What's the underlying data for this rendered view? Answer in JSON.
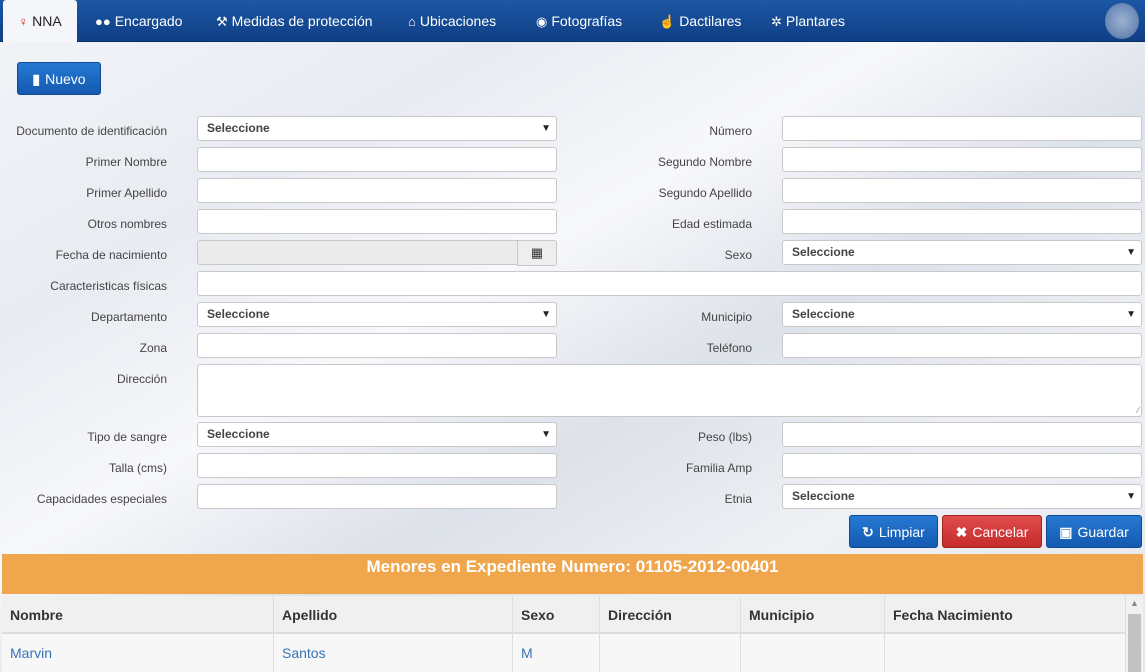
{
  "tabs": [
    {
      "label": "NNA",
      "icon": "child-icon",
      "glyph": "♀"
    },
    {
      "label": "Encargado",
      "icon": "users-icon",
      "glyph": "👥"
    },
    {
      "label": "Medidas de protección",
      "icon": "gavel-icon",
      "glyph": "⚒"
    },
    {
      "label": "Ubicaciones",
      "icon": "home-icon",
      "glyph": "⌂"
    },
    {
      "label": "Fotografías",
      "icon": "camera-icon",
      "glyph": "◙"
    },
    {
      "label": "Dactilares",
      "icon": "hand-icon",
      "glyph": "☝"
    },
    {
      "label": "Plantares",
      "icon": "footprint-icon",
      "glyph": "✲"
    }
  ],
  "nuevo_label": "Nuevo",
  "select_placeholder": "Seleccione",
  "form": {
    "documento": "Documento de identificación",
    "numero": "Número",
    "primer_nombre": "Primer Nombre",
    "segundo_nombre": "Segundo Nombre",
    "primer_apellido": "Primer Apellido",
    "segundo_apellido": "Segundo Apellido",
    "otros_nombres": "Otros nombres",
    "edad_estimada": "Edad estimada",
    "fecha_nacimiento": "Fecha de nacimiento",
    "sexo": "Sexo",
    "caracteristicas": "Caracteristicas físicas",
    "departamento": "Departamento",
    "municipio": "Municipio",
    "zona": "Zona",
    "telefono": "Teléfono",
    "direccion": "Dirección",
    "tipo_sangre": "Tipo de sangre",
    "peso": "Peso (lbs)",
    "talla": "Talla (cms)",
    "familia_amp": "Familia Amp",
    "capacidades": "Capacidades especiales",
    "etnia": "Etnia"
  },
  "actions": {
    "limpiar": "Limpiar",
    "cancelar": "Cancelar",
    "guardar": "Guardar"
  },
  "banner": "Menores en Expediente Numero: 01105-2012-00401",
  "table": {
    "headers": [
      "Nombre",
      "Apellido",
      "Sexo",
      "Dirección",
      "Municipio",
      "Fecha Nacimiento"
    ],
    "rows": [
      [
        "Marvin",
        "Santos",
        "M",
        "",
        "",
        ""
      ]
    ]
  },
  "colors": {
    "nav": "#1d57a5",
    "primary": "#1a66c2",
    "danger": "#d43c3c",
    "banner": "#efa64d",
    "link": "#3a73b8"
  }
}
